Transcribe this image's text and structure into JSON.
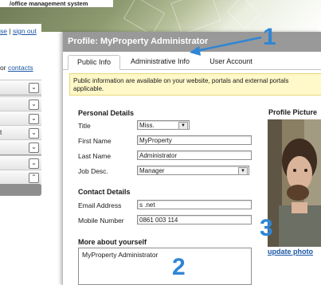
{
  "banner": {
    "title": "/office management system"
  },
  "sidebar": {
    "link_close": "se",
    "link_separator": "|",
    "link_signout": "sign out",
    "contacts_prefix": "or",
    "contacts_link": "contacts",
    "items": [
      {
        "label": "",
        "chevron": "⌄"
      },
      {
        "label": "",
        "chevron": "⌄"
      },
      {
        "label": "",
        "chevron": "⌄"
      },
      {
        "label": "t",
        "chevron": "⌄"
      },
      {
        "label": "",
        "chevron": "⌄"
      },
      {
        "label": "",
        "chevron": "⌄"
      },
      {
        "label": "",
        "chevron": "⌃"
      }
    ]
  },
  "panel": {
    "title": "Profile: MyProperty Administrator",
    "tabs": [
      {
        "label": "Public Info",
        "active": true
      },
      {
        "label": "Administrative Info",
        "active": false
      },
      {
        "label": "User Account",
        "active": false
      }
    ],
    "notice": "Public information are available on your website, portals and external portals applicable."
  },
  "personal": {
    "heading": "Personal Details",
    "title_label": "Title",
    "title_value": "Miss.",
    "first_name_label": "First Name",
    "first_name_value": "MyProperty",
    "last_name_label": "Last Name",
    "last_name_value": "Administrator",
    "job_label": "Job Desc.",
    "job_value": "Manager"
  },
  "contact": {
    "heading": "Contact Details",
    "email_label": "Email Address",
    "email_value": "s                .net",
    "mobile_label": "Mobile Number",
    "mobile_value": "0861 003 114"
  },
  "about": {
    "heading": "More about yourself",
    "value": "MyProperty Administrator"
  },
  "profile_picture": {
    "heading": "Profile Picture",
    "update_link": "update photo"
  },
  "annotations": {
    "a1": "1",
    "a2": "2",
    "a3": "3"
  },
  "colors": {
    "header": "#999999",
    "notice_bg": "#fff8c8",
    "link": "#1a55a5",
    "annotation": "#2f86d6"
  }
}
